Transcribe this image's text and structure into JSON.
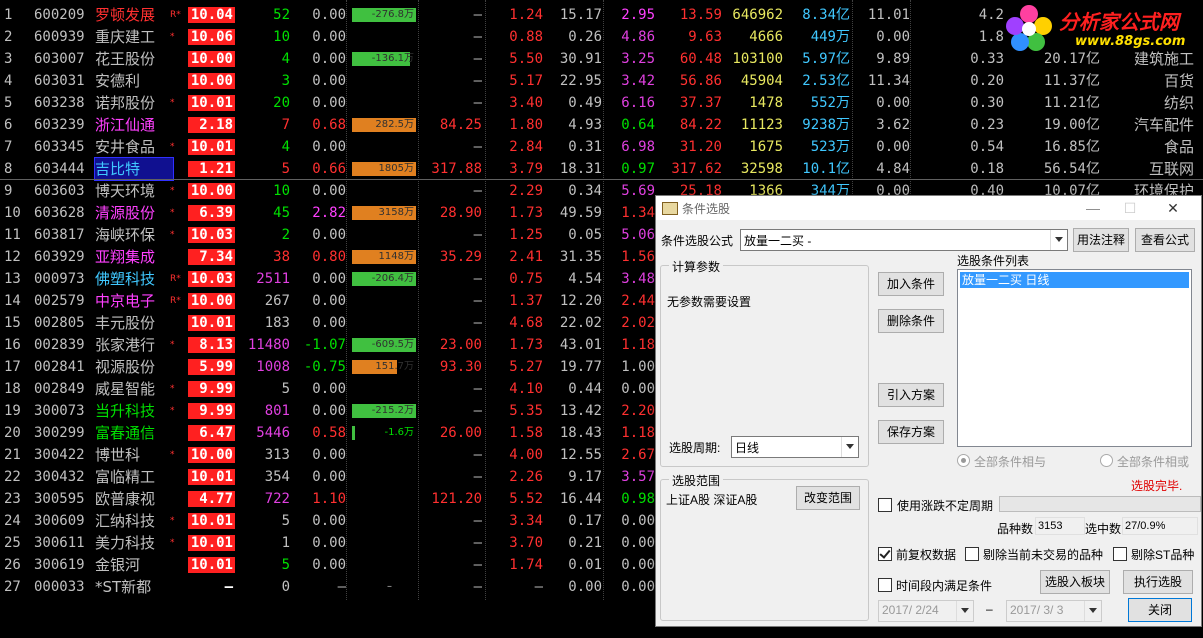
{
  "logo": {
    "title": "分析家公式网",
    "url": "www.88gs.com"
  },
  "rows": [
    {
      "no": "1",
      "code": "600209",
      "name": "罗顿发展",
      "name_color": "#ff3030",
      "flag": "R*",
      "pct": "10.04",
      "pct_color": "#ff2020",
      "vol": "52",
      "vol_color": "#00e000",
      "chg": "0.00",
      "chg_color": "#c0c0c0",
      "bar_text": "-276.8万",
      "bar_color": "#40c040",
      "bar_frac": 1.0,
      "c9": "–",
      "c9_color": "#c0c0c0",
      "c10": "1.24",
      "c10_color": "#ff3030",
      "c11": "15.17",
      "c12": "2.95",
      "c12_color": "#ff40ff",
      "c13": "13.59",
      "c13_color": "#ff3030",
      "c14": "646962",
      "c15": "8.34亿",
      "c16": "11.01",
      "c17": "4.2",
      "c18": "",
      "c19": ""
    },
    {
      "no": "2",
      "code": "600939",
      "name": "重庆建工",
      "name_color": "#c0c0c0",
      "flag": "*",
      "pct": "10.06",
      "pct_color": "#ff2020",
      "vol": "10",
      "vol_color": "#00e000",
      "chg": "0.00",
      "chg_color": "#c0c0c0",
      "bar_text": "",
      "bar_color": "",
      "bar_frac": 0,
      "c9": "–",
      "c9_color": "#c0c0c0",
      "c10": "0.88",
      "c10_color": "#ff3030",
      "c11": "0.26",
      "c12": "4.86",
      "c12_color": "#e040e0",
      "c13": "9.63",
      "c13_color": "#ff3030",
      "c14": "4666",
      "c15": "449万",
      "c16": "0.00",
      "c17": "1.8",
      "c18": "",
      "c19": ""
    },
    {
      "no": "3",
      "code": "603007",
      "name": "花王股份",
      "name_color": "#c0c0c0",
      "flag": "",
      "pct": "10.00",
      "pct_color": "#ff2020",
      "vol": "4",
      "vol_color": "#00e000",
      "chg": "0.00",
      "chg_color": "#c0c0c0",
      "bar_text": "-136.1万",
      "bar_color": "#40c040",
      "bar_frac": 0.9,
      "c9": "–",
      "c9_color": "#c0c0c0",
      "c10": "5.50",
      "c10_color": "#ff3030",
      "c11": "30.91",
      "c12": "3.25",
      "c12_color": "#e040e0",
      "c13": "60.48",
      "c13_color": "#ff3030",
      "c14": "103100",
      "c15": "5.97亿",
      "c16": "9.89",
      "c17": "0.33",
      "c18": "20.17亿",
      "c19": "建筑施工"
    },
    {
      "no": "4",
      "code": "603031",
      "name": "安德利",
      "name_color": "#c0c0c0",
      "flag": "",
      "pct": "10.00",
      "pct_color": "#ff2020",
      "vol": "3",
      "vol_color": "#00e000",
      "chg": "0.00",
      "chg_color": "#c0c0c0",
      "bar_text": "",
      "bar_color": "",
      "bar_frac": 0,
      "c9": "–",
      "c9_color": "#c0c0c0",
      "c10": "5.17",
      "c10_color": "#ff3030",
      "c11": "22.95",
      "c12": "3.42",
      "c12_color": "#e040e0",
      "c13": "56.86",
      "c13_color": "#ff3030",
      "c14": "45904",
      "c15": "2.53亿",
      "c16": "11.34",
      "c17": "0.20",
      "c18": "11.37亿",
      "c19": "百货"
    },
    {
      "no": "5",
      "code": "603238",
      "name": "诺邦股份",
      "name_color": "#c0c0c0",
      "flag": "*",
      "pct": "10.01",
      "pct_color": "#ff2020",
      "vol": "20",
      "vol_color": "#00e000",
      "chg": "0.00",
      "chg_color": "#c0c0c0",
      "bar_text": "",
      "bar_color": "",
      "bar_frac": 0,
      "c9": "–",
      "c9_color": "#c0c0c0",
      "c10": "3.40",
      "c10_color": "#ff3030",
      "c11": "0.49",
      "c12": "6.16",
      "c12_color": "#e040e0",
      "c13": "37.37",
      "c13_color": "#ff3030",
      "c14": "1478",
      "c15": "552万",
      "c16": "0.00",
      "c17": "0.30",
      "c18": "11.21亿",
      "c19": "纺织"
    },
    {
      "no": "6",
      "code": "603239",
      "name": "浙江仙通",
      "name_color": "#ff40ff",
      "flag": "",
      "pct": "2.18",
      "pct_color": "#ff2020",
      "vol": "7",
      "vol_color": "#ff3030",
      "chg": "0.68",
      "chg_color": "#ff3030",
      "bar_text": "282.5万",
      "bar_color": "#e08020",
      "bar_frac": 1.0,
      "c9": "84.25",
      "c9_color": "#ff3030",
      "c10": "1.80",
      "c10_color": "#ff3030",
      "c11": "4.93",
      "c12": "0.64",
      "c12_color": "#00e000",
      "c13": "84.22",
      "c13_color": "#ff3030",
      "c14": "11123",
      "c15": "9238万",
      "c16": "3.62",
      "c17": "0.23",
      "c18": "19.00亿",
      "c19": "汽车配件"
    },
    {
      "no": "7",
      "code": "603345",
      "name": "安井食品",
      "name_color": "#c0c0c0",
      "flag": "*",
      "pct": "10.01",
      "pct_color": "#ff2020",
      "vol": "4",
      "vol_color": "#00e000",
      "chg": "0.00",
      "chg_color": "#c0c0c0",
      "bar_text": "",
      "bar_color": "",
      "bar_frac": 0,
      "c9": "–",
      "c9_color": "#c0c0c0",
      "c10": "2.84",
      "c10_color": "#ff3030",
      "c11": "0.31",
      "c12": "6.98",
      "c12_color": "#e040e0",
      "c13": "31.20",
      "c13_color": "#ff3030",
      "c14": "1675",
      "c15": "523万",
      "c16": "0.00",
      "c17": "0.54",
      "c18": "16.85亿",
      "c19": "食品"
    },
    {
      "no": "8",
      "code": "603444",
      "name": "吉比特",
      "name_color": "#40c8ff",
      "flag": "",
      "pct": "1.21",
      "pct_color": "#ff2020",
      "vol": "5",
      "vol_color": "#ff3030",
      "chg": "0.66",
      "chg_color": "#ff3030",
      "bar_text": "1805万",
      "bar_color": "#e08020",
      "bar_frac": 1.0,
      "c9": "317.88",
      "c9_color": "#ff3030",
      "c10": "3.79",
      "c10_color": "#ff3030",
      "c11": "18.31",
      "c12": "0.97",
      "c12_color": "#00e000",
      "c13": "317.62",
      "c13_color": "#ff3030",
      "c14": "32598",
      "c15": "10.1亿",
      "c16": "4.84",
      "c17": "0.18",
      "c18": "56.54亿",
      "c19": "互联网"
    },
    {
      "no": "9",
      "code": "603603",
      "name": "博天环境",
      "name_color": "#c0c0c0",
      "flag": "*",
      "pct": "10.00",
      "pct_color": "#ff2020",
      "vol": "10",
      "vol_color": "#00e000",
      "chg": "0.00",
      "chg_color": "#c0c0c0",
      "bar_text": "",
      "bar_color": "",
      "bar_frac": 0,
      "c9": "–",
      "c9_color": "#c0c0c0",
      "c10": "2.29",
      "c10_color": "#ff3030",
      "c11": "0.34",
      "c12": "5.69",
      "c12_color": "#e040e0",
      "c13": "25.18",
      "c13_color": "#ff3030",
      "c14": "1366",
      "c15": "344万",
      "c16": "0.00",
      "c17": "0.40",
      "c18": "10.07亿",
      "c19": "环境保护"
    },
    {
      "no": "10",
      "code": "603628",
      "name": "清源股份",
      "name_color": "#ff40ff",
      "flag": "*",
      "pct": "6.39",
      "pct_color": "#ff2020",
      "vol": "45",
      "vol_color": "#00e000",
      "chg": "2.82",
      "chg_color": "#ff40ff",
      "bar_text": "3158万",
      "bar_color": "#e08020",
      "bar_frac": 1.0,
      "c9": "28.90",
      "c9_color": "#ff3030",
      "c10": "1.73",
      "c10_color": "#ff3030",
      "c11": "49.59",
      "c12": "1.34",
      "c12_color": "#ff3030",
      "c13": "",
      "c13_color": "#ff3030",
      "c14": "",
      "c15": "",
      "c16": "",
      "c17": "",
      "c18": "",
      "c19": ""
    },
    {
      "no": "11",
      "code": "603817",
      "name": "海峡环保",
      "name_color": "#c0c0c0",
      "flag": "*",
      "pct": "10.03",
      "pct_color": "#ff2020",
      "vol": "2",
      "vol_color": "#00e000",
      "chg": "0.00",
      "chg_color": "#c0c0c0",
      "bar_text": "",
      "bar_color": "",
      "bar_frac": 0,
      "c9": "–",
      "c9_color": "#c0c0c0",
      "c10": "1.25",
      "c10_color": "#ff3030",
      "c11": "0.05",
      "c12": "5.06",
      "c12_color": "#e040e0",
      "c13": "",
      "c13_color": "#ff3030",
      "c14": "",
      "c15": "",
      "c16": "",
      "c17": "",
      "c18": "",
      "c19": ""
    },
    {
      "no": "12",
      "code": "603929",
      "name": "亚翔集成",
      "name_color": "#ff40ff",
      "flag": "",
      "pct": "7.34",
      "pct_color": "#ff2020",
      "vol": "38",
      "vol_color": "#ff3030",
      "chg": "0.80",
      "chg_color": "#ff3030",
      "bar_text": "1148万",
      "bar_color": "#e08020",
      "bar_frac": 1.0,
      "c9": "35.29",
      "c9_color": "#ff3030",
      "c10": "2.41",
      "c10_color": "#ff3030",
      "c11": "31.35",
      "c12": "1.56",
      "c12_color": "#ff3030",
      "c13": "",
      "c13_color": "#ff3030",
      "c14": "",
      "c15": "",
      "c16": "",
      "c17": "",
      "c18": "",
      "c19": ""
    },
    {
      "no": "13",
      "code": "000973",
      "name": "佛塑科技",
      "name_color": "#40c8ff",
      "flag": "R*",
      "pct": "10.03",
      "pct_color": "#ff2020",
      "vol": "2511",
      "vol_color": "#e040e0",
      "chg": "0.00",
      "chg_color": "#c0c0c0",
      "bar_text": "-206.4万",
      "bar_color": "#40c040",
      "bar_frac": 1.0,
      "c9": "–",
      "c9_color": "#c0c0c0",
      "c10": "0.75",
      "c10_color": "#ff3030",
      "c11": "4.54",
      "c12": "3.48",
      "c12_color": "#e040e0",
      "c13": "",
      "c13_color": "#ff3030",
      "c14": "",
      "c15": "",
      "c16": "",
      "c17": "",
      "c18": "",
      "c19": ""
    },
    {
      "no": "14",
      "code": "002579",
      "name": "中京电子",
      "name_color": "#ff40ff",
      "flag": "R*",
      "pct": "10.00",
      "pct_color": "#ff2020",
      "vol": "267",
      "vol_color": "#c0c0c0",
      "chg": "0.00",
      "chg_color": "#c0c0c0",
      "bar_text": "",
      "bar_color": "",
      "bar_frac": 0,
      "c9": "–",
      "c9_color": "#c0c0c0",
      "c10": "1.37",
      "c10_color": "#ff3030",
      "c11": "12.20",
      "c12": "2.44",
      "c12_color": "#ff3030",
      "c13": "",
      "c13_color": "#ff3030",
      "c14": "",
      "c15": "",
      "c16": "",
      "c17": "",
      "c18": "",
      "c19": ""
    },
    {
      "no": "15",
      "code": "002805",
      "name": "丰元股份",
      "name_color": "#c0c0c0",
      "flag": "",
      "pct": "10.01",
      "pct_color": "#ff2020",
      "vol": "183",
      "vol_color": "#c0c0c0",
      "chg": "0.00",
      "chg_color": "#c0c0c0",
      "bar_text": "",
      "bar_color": "",
      "bar_frac": 0,
      "c9": "–",
      "c9_color": "#c0c0c0",
      "c10": "4.68",
      "c10_color": "#ff3030",
      "c11": "22.02",
      "c12": "2.02",
      "c12_color": "#ff3030",
      "c13": "",
      "c13_color": "#ff3030",
      "c14": "",
      "c15": "",
      "c16": "",
      "c17": "",
      "c18": "",
      "c19": ""
    },
    {
      "no": "16",
      "code": "002839",
      "name": "张家港行",
      "name_color": "#c0c0c0",
      "flag": "*",
      "pct": "8.13",
      "pct_color": "#ff2020",
      "vol": "11480",
      "vol_color": "#e040e0",
      "chg": "-1.07",
      "chg_color": "#00e000",
      "bar_text": "-609.5万",
      "bar_color": "#40c040",
      "bar_frac": 1.0,
      "c9": "23.00",
      "c9_color": "#ff3030",
      "c10": "1.73",
      "c10_color": "#ff3030",
      "c11": "43.01",
      "c12": "1.18",
      "c12_color": "#ff3030",
      "c13": "",
      "c13_color": "#ff3030",
      "c14": "",
      "c15": "",
      "c16": "",
      "c17": "",
      "c18": "",
      "c19": ""
    },
    {
      "no": "17",
      "code": "002841",
      "name": "视源股份",
      "name_color": "#c0c0c0",
      "flag": "",
      "pct": "5.99",
      "pct_color": "#ff2020",
      "vol": "1008",
      "vol_color": "#e040e0",
      "chg": "-0.75",
      "chg_color": "#00e000",
      "bar_text": "151.7万",
      "bar_color": "#e08020",
      "bar_frac": 0.7,
      "c9": "93.30",
      "c9_color": "#ff3030",
      "c10": "5.27",
      "c10_color": "#ff3030",
      "c11": "19.77",
      "c12": "1.00",
      "c12_color": "#c0c0c0",
      "c13": "",
      "c13_color": "#ff3030",
      "c14": "",
      "c15": "",
      "c16": "",
      "c17": "",
      "c18": "",
      "c19": ""
    },
    {
      "no": "18",
      "code": "002849",
      "name": "威星智能",
      "name_color": "#c0c0c0",
      "flag": "*",
      "pct": "9.99",
      "pct_color": "#ff2020",
      "vol": "5",
      "vol_color": "#c0c0c0",
      "chg": "0.00",
      "chg_color": "#c0c0c0",
      "bar_text": "",
      "bar_color": "",
      "bar_frac": 0,
      "c9": "–",
      "c9_color": "#c0c0c0",
      "c10": "4.10",
      "c10_color": "#ff3030",
      "c11": "0.44",
      "c12": "0.00",
      "c12_color": "#c0c0c0",
      "c13": "",
      "c13_color": "#ff3030",
      "c14": "",
      "c15": "",
      "c16": "",
      "c17": "",
      "c18": "",
      "c19": ""
    },
    {
      "no": "19",
      "code": "300073",
      "name": "当升科技",
      "name_color": "#00e000",
      "flag": "*",
      "pct": "9.99",
      "pct_color": "#ff2020",
      "vol": "801",
      "vol_color": "#e040e0",
      "chg": "0.00",
      "chg_color": "#c0c0c0",
      "bar_text": "-215.2万",
      "bar_color": "#40c040",
      "bar_frac": 1.0,
      "c9": "–",
      "c9_color": "#c0c0c0",
      "c10": "5.35",
      "c10_color": "#ff3030",
      "c11": "13.42",
      "c12": "2.20",
      "c12_color": "#ff3030",
      "c13": "",
      "c13_color": "#ff3030",
      "c14": "",
      "c15": "",
      "c16": "",
      "c17": "",
      "c18": "",
      "c19": ""
    },
    {
      "no": "20",
      "code": "300299",
      "name": "富春通信",
      "name_color": "#00e000",
      "flag": "",
      "pct": "6.47",
      "pct_color": "#ff2020",
      "vol": "5446",
      "vol_color": "#e040e0",
      "chg": "0.58",
      "chg_color": "#ff3030",
      "bar_text": "-1.6万",
      "bar_color": "#40c040",
      "bar_frac": 0.05,
      "c9": "26.00",
      "c9_color": "#ff3030",
      "c10": "1.58",
      "c10_color": "#ff3030",
      "c11": "18.43",
      "c12": "1.18",
      "c12_color": "#ff3030",
      "c13": "",
      "c13_color": "#ff3030",
      "c14": "",
      "c15": "",
      "c16": "",
      "c17": "",
      "c18": "",
      "c19": ""
    },
    {
      "no": "21",
      "code": "300422",
      "name": "博世科",
      "name_color": "#c0c0c0",
      "flag": "*",
      "pct": "10.00",
      "pct_color": "#ff2020",
      "vol": "313",
      "vol_color": "#c0c0c0",
      "chg": "0.00",
      "chg_color": "#c0c0c0",
      "bar_text": "",
      "bar_color": "",
      "bar_frac": 0,
      "c9": "–",
      "c9_color": "#c0c0c0",
      "c10": "4.00",
      "c10_color": "#ff3030",
      "c11": "12.55",
      "c12": "2.67",
      "c12_color": "#ff3030",
      "c13": "",
      "c13_color": "#ff3030",
      "c14": "",
      "c15": "",
      "c16": "",
      "c17": "",
      "c18": "",
      "c19": ""
    },
    {
      "no": "22",
      "code": "300432",
      "name": "富临精工",
      "name_color": "#c0c0c0",
      "flag": "",
      "pct": "10.01",
      "pct_color": "#ff2020",
      "vol": "354",
      "vol_color": "#c0c0c0",
      "chg": "0.00",
      "chg_color": "#c0c0c0",
      "bar_text": "",
      "bar_color": "",
      "bar_frac": 0,
      "c9": "–",
      "c9_color": "#c0c0c0",
      "c10": "2.26",
      "c10_color": "#ff3030",
      "c11": "9.17",
      "c12": "3.57",
      "c12_color": "#e040e0",
      "c13": "",
      "c13_color": "#ff3030",
      "c14": "",
      "c15": "",
      "c16": "",
      "c17": "",
      "c18": "",
      "c19": ""
    },
    {
      "no": "23",
      "code": "300595",
      "name": "欧普康视",
      "name_color": "#c0c0c0",
      "flag": "",
      "pct": "4.77",
      "pct_color": "#ff2020",
      "vol": "722",
      "vol_color": "#e040e0",
      "chg": "1.10",
      "chg_color": "#ff3030",
      "bar_text": "",
      "bar_color": "",
      "bar_frac": 0,
      "c9": "121.20",
      "c9_color": "#ff3030",
      "c10": "5.52",
      "c10_color": "#ff3030",
      "c11": "16.44",
      "c12": "0.98",
      "c12_color": "#00e000",
      "c13": "",
      "c13_color": "#ff3030",
      "c14": "",
      "c15": "",
      "c16": "",
      "c17": "",
      "c18": "",
      "c19": ""
    },
    {
      "no": "24",
      "code": "300609",
      "name": "汇纳科技",
      "name_color": "#c0c0c0",
      "flag": "*",
      "pct": "10.01",
      "pct_color": "#ff2020",
      "vol": "5",
      "vol_color": "#c0c0c0",
      "chg": "0.00",
      "chg_color": "#c0c0c0",
      "bar_text": "",
      "bar_color": "",
      "bar_frac": 0,
      "c9": "–",
      "c9_color": "#c0c0c0",
      "c10": "3.34",
      "c10_color": "#ff3030",
      "c11": "0.17",
      "c12": "0.00",
      "c12_color": "#c0c0c0",
      "c13": "",
      "c13_color": "#ff3030",
      "c14": "",
      "c15": "",
      "c16": "",
      "c17": "",
      "c18": "",
      "c19": ""
    },
    {
      "no": "25",
      "code": "300611",
      "name": "美力科技",
      "name_color": "#c0c0c0",
      "flag": "*",
      "pct": "10.01",
      "pct_color": "#ff2020",
      "vol": "1",
      "vol_color": "#c0c0c0",
      "chg": "0.00",
      "chg_color": "#c0c0c0",
      "bar_text": "",
      "bar_color": "",
      "bar_frac": 0,
      "c9": "–",
      "c9_color": "#c0c0c0",
      "c10": "3.70",
      "c10_color": "#ff3030",
      "c11": "0.21",
      "c12": "0.00",
      "c12_color": "#c0c0c0",
      "c13": "",
      "c13_color": "#ff3030",
      "c14": "",
      "c15": "",
      "c16": "",
      "c17": "",
      "c18": "",
      "c19": ""
    },
    {
      "no": "26",
      "code": "300619",
      "name": "金银河",
      "name_color": "#c0c0c0",
      "flag": "",
      "pct": "10.01",
      "pct_color": "#ff2020",
      "vol": "5",
      "vol_color": "#00e000",
      "chg": "0.00",
      "chg_color": "#c0c0c0",
      "bar_text": "",
      "bar_color": "",
      "bar_frac": 0,
      "c9": "–",
      "c9_color": "#c0c0c0",
      "c10": "1.74",
      "c10_color": "#ff3030",
      "c11": "0.01",
      "c12": "0.00",
      "c12_color": "#c0c0c0",
      "c13": "",
      "c13_color": "#ff3030",
      "c14": "",
      "c15": "",
      "c16": "",
      "c17": "",
      "c18": "",
      "c19": ""
    },
    {
      "no": "27",
      "code": "000033",
      "name": "*ST新都",
      "name_color": "#c0c0c0",
      "flag": "",
      "pct": "–",
      "pct_color": "",
      "vol": "0",
      "vol_color": "#c0c0c0",
      "chg": "–",
      "chg_color": "#c0c0c0",
      "bar_text": "–",
      "bar_color": "",
      "bar_frac": 0,
      "c9": "–",
      "c9_color": "#c0c0c0",
      "c10": "–",
      "c10_color": "#c0c0c0",
      "c11": "0.00",
      "c12": "0.00",
      "c12_color": "#c0c0c0",
      "c13": "",
      "c13_color": "#ff3030",
      "c14": "",
      "c15": "",
      "c16": "",
      "c17": "",
      "c18": "",
      "c19": ""
    }
  ],
  "dialog": {
    "title": "条件选股",
    "formula_label": "条件选股公式",
    "formula_value": "放量一二买    -",
    "usage_button": "用法注释",
    "view_formula_button": "查看公式",
    "params_group": "计算参数",
    "no_params_text": "无参数需要设置",
    "period_label": "选股周期:",
    "period_value": "日线",
    "add_condition": "加入条件",
    "delete_condition": "删除条件",
    "import_plan": "引入方案",
    "save_plan": "保存方案",
    "condition_list_label": "选股条件列表",
    "condition_items": [
      "放量一二买   日线"
    ],
    "radio_and": "全部条件相与",
    "radio_or": "全部条件相或",
    "status": "选股完毕.",
    "scope_group": "选股范围",
    "scope_text": "上证A股 深证A股",
    "change_scope": "改变范围",
    "use_range_period": "使用涨跌不定周期",
    "count_label": "品种数",
    "count_value": "3153",
    "selected_label": "选中数",
    "selected_value": "27/0.9%",
    "prev_adjust": "前复权数据",
    "exclude_nontrade": "剔除当前未交易的品种",
    "exclude_st": "剔除ST品种",
    "time_range": "时间段内满足条件",
    "to_block": "选股入板块",
    "run": "执行选股",
    "date_from": "2017/ 2/24",
    "date_sep": "–",
    "date_to": "2017/ 3/ 3",
    "close": "关闭"
  }
}
